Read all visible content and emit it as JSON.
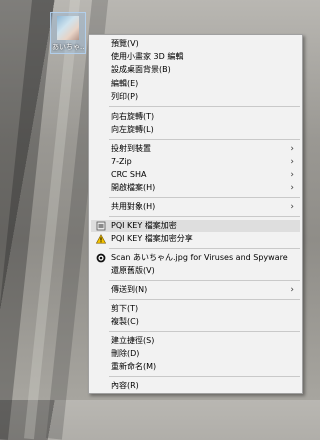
{
  "desktop": {
    "icon_label": "あいちゃ..."
  },
  "menu": {
    "items": [
      {
        "label": "預覽(V)",
        "submenu": false
      },
      {
        "label": "使用小畫家 3D 編輯",
        "submenu": false
      },
      {
        "label": "設成桌面背景(B)",
        "submenu": false
      },
      {
        "label": "編輯(E)",
        "submenu": false
      },
      {
        "label": "列印(P)",
        "submenu": false
      },
      {
        "label": "向右旋轉(T)",
        "submenu": false
      },
      {
        "label": "向左旋轉(L)",
        "submenu": false
      },
      {
        "label": "投射到裝置",
        "submenu": true
      },
      {
        "label": "7-Zip",
        "submenu": true
      },
      {
        "label": "CRC SHA",
        "submenu": true
      },
      {
        "label": "開啟檔案(H)",
        "submenu": true
      },
      {
        "label": "共用對象(H)",
        "submenu": true
      },
      {
        "label": "PQI KEY 檔案加密",
        "submenu": false
      },
      {
        "label": "PQI KEY 檔案加密分享",
        "submenu": false
      },
      {
        "label": "Scan あいちゃん.jpg for Viruses and Spyware",
        "submenu": false
      },
      {
        "label": "還原舊版(V)",
        "submenu": false
      },
      {
        "label": "傳送到(N)",
        "submenu": true
      },
      {
        "label": "剪下(T)",
        "submenu": false
      },
      {
        "label": "複製(C)",
        "submenu": false
      },
      {
        "label": "建立捷徑(S)",
        "submenu": false
      },
      {
        "label": "刪除(D)",
        "submenu": false
      },
      {
        "label": "重新命名(M)",
        "submenu": false
      },
      {
        "label": "內容(R)",
        "submenu": false
      }
    ],
    "submenu_arrow": "›",
    "colors": {
      "menu_bg": "#f2f2f2",
      "highlight_bg": "#dedede",
      "separator": "#c9c9c9"
    },
    "icons": [
      "pqi-key-icon",
      "warning-icon",
      "antivirus-scan-icon"
    ]
  }
}
